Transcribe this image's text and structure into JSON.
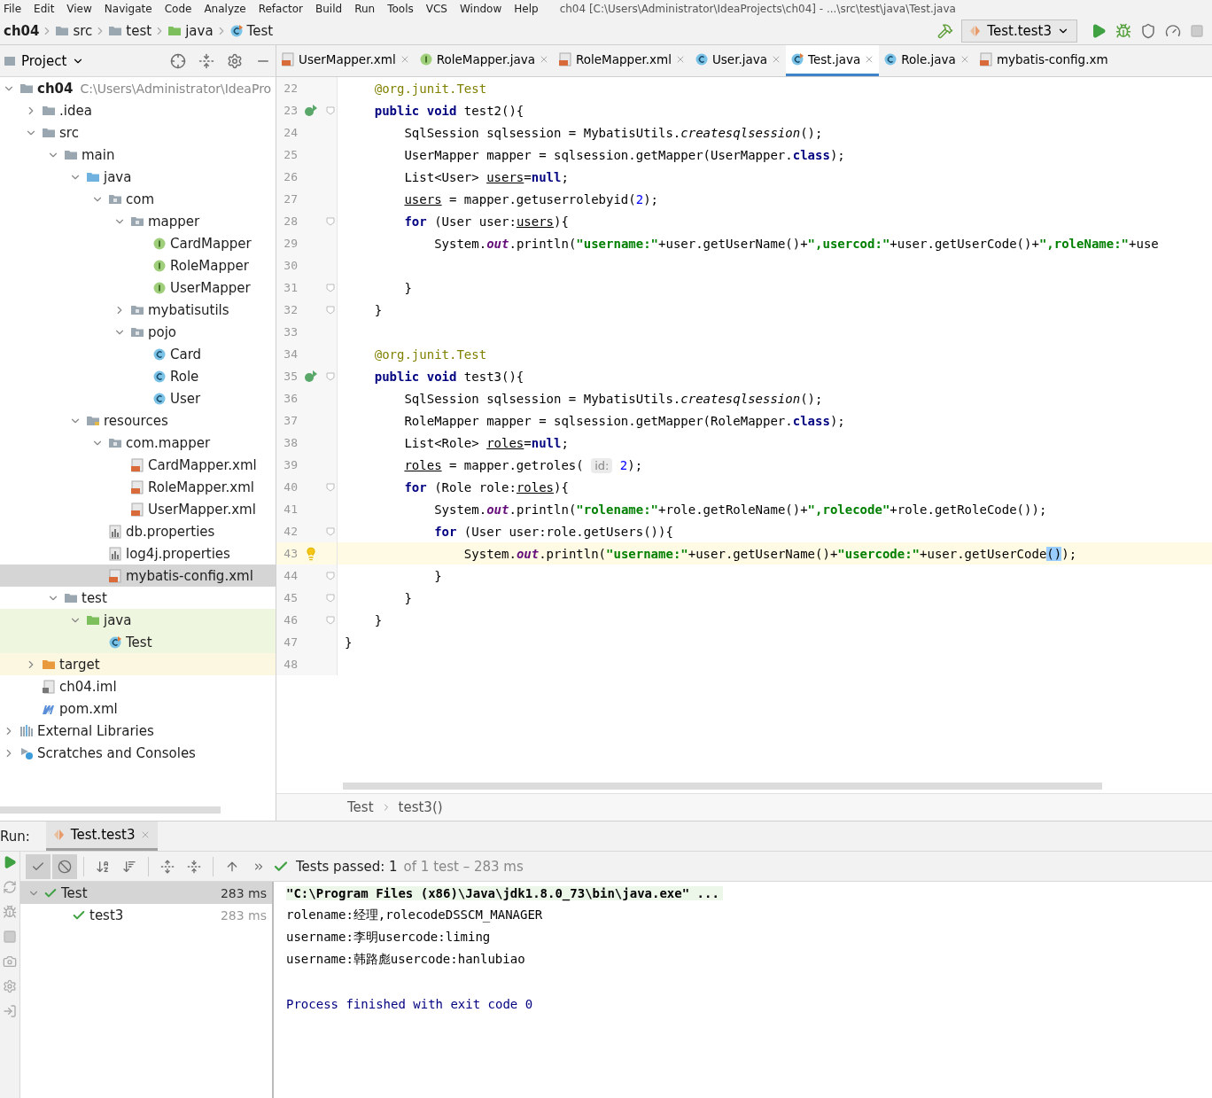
{
  "menu_bar": {
    "items": [
      "File",
      "Edit",
      "View",
      "Navigate",
      "Code",
      "Analyze",
      "Refactor",
      "Build",
      "Run",
      "Tools",
      "VCS",
      "Window",
      "Help"
    ],
    "title": "ch04 [C:\\Users\\Administrator\\IdeaProjects\\ch04] - ...\\src\\test\\java\\Test.java"
  },
  "nav_bar": {
    "crumbs": [
      {
        "label": "ch04",
        "kind": "module"
      },
      {
        "label": "src",
        "kind": "folder"
      },
      {
        "label": "test",
        "kind": "folder"
      },
      {
        "label": "java",
        "kind": "test-root"
      },
      {
        "label": "Test",
        "kind": "test-class"
      }
    ],
    "run_config": "Test.test3"
  },
  "project_panel": {
    "title": "Project",
    "tree": [
      {
        "label": "ch04",
        "kind": "module",
        "hint": "C:\\Users\\Administrator\\IdeaPro",
        "expanded": true,
        "selected": false,
        "children": [
          {
            "label": ".idea",
            "kind": "folder",
            "expanded": false,
            "selected": false
          },
          {
            "label": "src",
            "kind": "folder",
            "expanded": true,
            "selected": false,
            "children": [
              {
                "label": "main",
                "kind": "folder",
                "expanded": true,
                "selected": false,
                "children": [
                  {
                    "label": "java",
                    "kind": "source-root",
                    "expanded": true,
                    "selected": false,
                    "children": [
                      {
                        "label": "com",
                        "kind": "package",
                        "expanded": true,
                        "selected": false,
                        "children": [
                          {
                            "label": "mapper",
                            "kind": "package",
                            "expanded": true,
                            "selected": false,
                            "children": [
                              {
                                "label": "CardMapper",
                                "kind": "interface",
                                "selected": false
                              },
                              {
                                "label": "RoleMapper",
                                "kind": "interface",
                                "selected": false
                              },
                              {
                                "label": "UserMapper",
                                "kind": "interface",
                                "selected": false
                              }
                            ]
                          },
                          {
                            "label": "mybatisutils",
                            "kind": "package",
                            "expanded": false,
                            "selected": false
                          },
                          {
                            "label": "pojo",
                            "kind": "package",
                            "expanded": true,
                            "selected": false,
                            "children": [
                              {
                                "label": "Card",
                                "kind": "class",
                                "selected": false
                              },
                              {
                                "label": "Role",
                                "kind": "class",
                                "selected": false
                              },
                              {
                                "label": "User",
                                "kind": "class",
                                "selected": false
                              }
                            ]
                          }
                        ]
                      }
                    ]
                  },
                  {
                    "label": "resources",
                    "kind": "resources-root",
                    "expanded": true,
                    "selected": false,
                    "children": [
                      {
                        "label": "com.mapper",
                        "kind": "package",
                        "expanded": true,
                        "selected": false,
                        "children": [
                          {
                            "label": "CardMapper.xml",
                            "kind": "xml",
                            "selected": false
                          },
                          {
                            "label": "RoleMapper.xml",
                            "kind": "xml",
                            "selected": false
                          },
                          {
                            "label": "UserMapper.xml",
                            "kind": "xml",
                            "selected": false
                          }
                        ]
                      },
                      {
                        "label": "db.properties",
                        "kind": "properties",
                        "selected": false
                      },
                      {
                        "label": "log4j.properties",
                        "kind": "properties",
                        "selected": false
                      },
                      {
                        "label": "mybatis-config.xml",
                        "kind": "xml",
                        "selected": true
                      }
                    ]
                  }
                ]
              },
              {
                "label": "test",
                "kind": "folder",
                "expanded": true,
                "selected": false,
                "children": [
                  {
                    "label": "java",
                    "kind": "test-root",
                    "expanded": true,
                    "selected": false,
                    "children": [
                      {
                        "label": "Test",
                        "kind": "test-class",
                        "selected": false
                      }
                    ]
                  }
                ]
              }
            ]
          },
          {
            "label": "target",
            "kind": "excluded",
            "expanded": false,
            "selected": false
          },
          {
            "label": "ch04.iml",
            "kind": "iml",
            "selected": false
          },
          {
            "label": "pom.xml",
            "kind": "maven",
            "selected": false
          }
        ]
      },
      {
        "label": "External Libraries",
        "kind": "libraries",
        "expanded": false,
        "selected": false
      },
      {
        "label": "Scratches and Consoles",
        "kind": "scratches",
        "expanded": false,
        "selected": false
      }
    ]
  },
  "editor_tabs": [
    {
      "label": "UserMapper.xml",
      "kind": "xml",
      "selected": false
    },
    {
      "label": "RoleMapper.java",
      "kind": "interface",
      "selected": false
    },
    {
      "label": "RoleMapper.xml",
      "kind": "xml",
      "selected": false
    },
    {
      "label": "User.java",
      "kind": "class",
      "selected": false
    },
    {
      "label": "Test.java",
      "kind": "test-class",
      "selected": true
    },
    {
      "label": "Role.java",
      "kind": "class",
      "selected": false
    },
    {
      "label": "mybatis-config.xm",
      "kind": "xml",
      "selected": false
    }
  ],
  "editor": {
    "lines": [
      {
        "children": [
          {
            "number": "22",
            "tokens": [
              {
                "kind": "ann",
                "text": "@org.junit.Test"
              }
            ]
          },
          {
            "number": "23",
            "run": true,
            "fold": true,
            "tokens": [
              {
                "kind": "kw",
                "text": "public void"
              },
              {
                "kind": "plain",
                "text": " test2(){"
              }
            ],
            "children": [
              {
                "number": "24",
                "tokens": [
                  {
                    "kind": "plain",
                    "text": "SqlSession sqlsession = MybatisUtils."
                  },
                  {
                    "kind": "italic",
                    "text": "createsqlsession"
                  },
                  {
                    "kind": "plain",
                    "text": "();"
                  }
                ]
              },
              {
                "number": "25",
                "tokens": [
                  {
                    "kind": "plain",
                    "text": "UserMapper mapper = sqlsession.getMapper(UserMapper."
                  },
                  {
                    "kind": "kw",
                    "text": "class"
                  },
                  {
                    "kind": "plain",
                    "text": ");"
                  }
                ]
              },
              {
                "number": "26",
                "tokens": [
                  {
                    "kind": "plain",
                    "text": "List<User> "
                  },
                  {
                    "kind": "var",
                    "text": "users"
                  },
                  {
                    "kind": "plain",
                    "text": "="
                  },
                  {
                    "kind": "kw",
                    "text": "null"
                  },
                  {
                    "kind": "plain",
                    "text": ";"
                  }
                ]
              },
              {
                "number": "27",
                "tokens": [
                  {
                    "kind": "var",
                    "text": "users"
                  },
                  {
                    "kind": "plain",
                    "text": " = mapper.getuserrolebyid("
                  },
                  {
                    "kind": "num",
                    "text": "2"
                  },
                  {
                    "kind": "plain",
                    "text": ");"
                  }
                ]
              },
              {
                "number": "28",
                "fold": true,
                "tokens": [
                  {
                    "kind": "kw",
                    "text": "for"
                  },
                  {
                    "kind": "plain",
                    "text": " (User user:"
                  },
                  {
                    "kind": "var",
                    "text": "users"
                  },
                  {
                    "kind": "plain",
                    "text": "){"
                  }
                ],
                "children": [
                  {
                    "number": "29",
                    "tokens": [
                      {
                        "kind": "plain",
                        "text": "System."
                      },
                      {
                        "kind": "field",
                        "text": "out"
                      },
                      {
                        "kind": "plain",
                        "text": ".println("
                      },
                      {
                        "kind": "str",
                        "text": "\"username:\""
                      },
                      {
                        "kind": "plain",
                        "text": "+user.getUserName()+"
                      },
                      {
                        "kind": "str",
                        "text": "\",usercod:\""
                      },
                      {
                        "kind": "plain",
                        "text": "+user.getUserCode()+"
                      },
                      {
                        "kind": "str",
                        "text": "\",roleName:\""
                      },
                      {
                        "kind": "plain",
                        "text": "+use"
                      }
                    ]
                  },
                  {
                    "number": "30"
                  }
                ]
              },
              {
                "number": "31",
                "fold": true,
                "tokens": [
                  {
                    "kind": "plain",
                    "text": "}"
                  }
                ]
              }
            ]
          },
          {
            "number": "32",
            "fold": true,
            "tokens": [
              {
                "kind": "plain",
                "text": "}"
              }
            ]
          },
          {
            "number": "33"
          },
          {
            "number": "34",
            "tokens": [
              {
                "kind": "ann",
                "text": "@org.junit.Test"
              }
            ]
          },
          {
            "number": "35",
            "run": true,
            "fold": true,
            "tokens": [
              {
                "kind": "kw",
                "text": "public void"
              },
              {
                "kind": "plain",
                "text": " test3(){"
              }
            ],
            "children": [
              {
                "number": "36",
                "tokens": [
                  {
                    "kind": "plain",
                    "text": "SqlSession sqlsession = MybatisUtils."
                  },
                  {
                    "kind": "italic",
                    "text": "createsqlsession"
                  },
                  {
                    "kind": "plain",
                    "text": "();"
                  }
                ]
              },
              {
                "number": "37",
                "tokens": [
                  {
                    "kind": "plain",
                    "text": "RoleMapper mapper = sqlsession.getMapper(RoleMapper."
                  },
                  {
                    "kind": "kw",
                    "text": "class"
                  },
                  {
                    "kind": "plain",
                    "text": ");"
                  }
                ]
              },
              {
                "number": "38",
                "tokens": [
                  {
                    "kind": "plain",
                    "text": "List<Role> "
                  },
                  {
                    "kind": "var",
                    "text": "roles"
                  },
                  {
                    "kind": "plain",
                    "text": "="
                  },
                  {
                    "kind": "kw",
                    "text": "null"
                  },
                  {
                    "kind": "plain",
                    "text": ";"
                  }
                ]
              },
              {
                "number": "39",
                "tokens": [
                  {
                    "kind": "var",
                    "text": "roles"
                  },
                  {
                    "kind": "plain",
                    "text": " = mapper.getroles( "
                  },
                  {
                    "kind": "hint",
                    "text": "id:"
                  },
                  {
                    "kind": "num",
                    "text": " 2"
                  },
                  {
                    "kind": "plain",
                    "text": ");"
                  }
                ]
              },
              {
                "number": "40",
                "fold": true,
                "tokens": [
                  {
                    "kind": "kw",
                    "text": "for"
                  },
                  {
                    "kind": "plain",
                    "text": " (Role role:"
                  },
                  {
                    "kind": "var",
                    "text": "roles"
                  },
                  {
                    "kind": "plain",
                    "text": "){"
                  }
                ],
                "children": [
                  {
                    "number": "41",
                    "tokens": [
                      {
                        "kind": "plain",
                        "text": "System."
                      },
                      {
                        "kind": "field",
                        "text": "out"
                      },
                      {
                        "kind": "plain",
                        "text": ".println("
                      },
                      {
                        "kind": "str",
                        "text": "\"rolename:\""
                      },
                      {
                        "kind": "plain",
                        "text": "+role.getRoleName()+"
                      },
                      {
                        "kind": "str",
                        "text": "\",rolecode\""
                      },
                      {
                        "kind": "plain",
                        "text": "+role.getRoleCode());"
                      }
                    ]
                  },
                  {
                    "number": "42",
                    "fold": true,
                    "tokens": [
                      {
                        "kind": "kw",
                        "text": "for"
                      },
                      {
                        "kind": "plain",
                        "text": " (User user:role.getUsers()){"
                      }
                    ],
                    "children": [
                      {
                        "number": "43",
                        "bulb": true,
                        "highlighted": true,
                        "tokens": [
                          {
                            "kind": "plain",
                            "text": "System."
                          },
                          {
                            "kind": "field",
                            "text": "out"
                          },
                          {
                            "kind": "plain",
                            "text": ".println("
                          },
                          {
                            "kind": "str",
                            "text": "\"username:\""
                          },
                          {
                            "kind": "plain",
                            "text": "+user.getUserName()+"
                          },
                          {
                            "kind": "str",
                            "text": "\"usercode:\""
                          },
                          {
                            "kind": "plain",
                            "text": "+user.getUserCode"
                          },
                          {
                            "kind": "match",
                            "text": "()"
                          },
                          {
                            "kind": "plain",
                            "text": ");"
                          }
                        ]
                      }
                    ]
                  },
                  {
                    "number": "44",
                    "fold": true,
                    "tokens": [
                      {
                        "kind": "plain",
                        "text": "}"
                      }
                    ]
                  }
                ]
              },
              {
                "number": "45",
                "fold": true,
                "tokens": [
                  {
                    "kind": "plain",
                    "text": "}"
                  }
                ]
              }
            ]
          },
          {
            "number": "46",
            "fold": true,
            "tokens": [
              {
                "kind": "plain",
                "text": "}"
              }
            ]
          }
        ]
      },
      {
        "number": "47",
        "tokens": [
          {
            "kind": "plain",
            "text": "}"
          }
        ]
      },
      {
        "number": "48"
      }
    ],
    "breadcrumbs": [
      "Test",
      "test3()"
    ]
  },
  "run_panel": {
    "label": "Run:",
    "tab": "Test.test3",
    "status": "Tests passed: 1",
    "status_detail": "of 1 test – 283 ms",
    "tests": [
      {
        "label": "Test",
        "time": "283 ms",
        "selected": true,
        "expanded": true,
        "children": [
          {
            "label": "test3",
            "time": "283 ms",
            "selected": false
          }
        ]
      }
    ],
    "console": [
      {
        "kind": "command",
        "text": "\"C:\\Program Files (x86)\\Java\\jdk1.8.0_73\\bin\\java.exe\" ..."
      },
      {
        "kind": "output",
        "text": "rolename:经理,rolecodeDSSCM_MANAGER"
      },
      {
        "kind": "output",
        "text": "username:李明usercode:liming"
      },
      {
        "kind": "output",
        "text": "username:韩路彪usercode:hanlubiao"
      },
      {
        "kind": "blank"
      },
      {
        "kind": "exit",
        "text": "Process finished with exit code 0"
      }
    ]
  }
}
